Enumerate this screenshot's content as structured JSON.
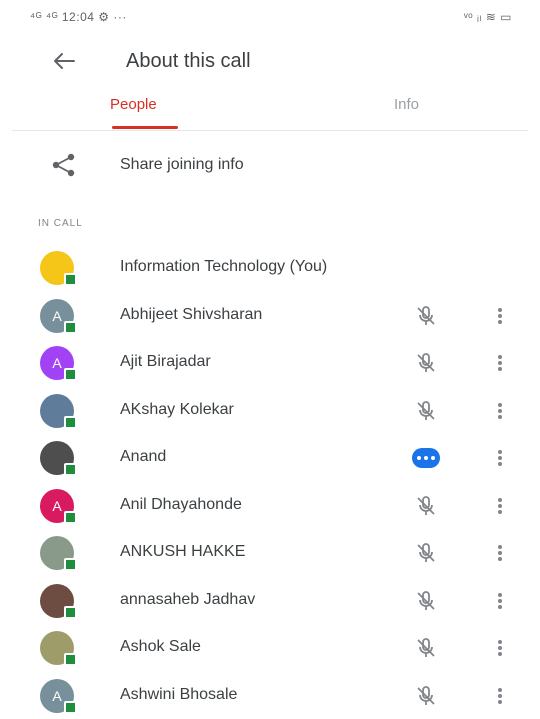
{
  "status_bar": {
    "left_text": "⁴ᴳ ⁴ᴳ 12:04 ⚙ ···",
    "right_text": "ᵛᵒ ᵢₗ ≋ ▭"
  },
  "app_bar": {
    "back_icon": "arrow-back-icon",
    "title": "About this call"
  },
  "tabs": {
    "items": [
      {
        "label": "People",
        "active": true
      },
      {
        "label": "Info",
        "active": false
      }
    ],
    "active_color": "#d93025"
  },
  "share": {
    "icon": "share-icon",
    "label": "Share joining info"
  },
  "section": {
    "in_call_label": "IN CALL"
  },
  "participants": [
    {
      "name": "Information Technology (You)",
      "initial": "",
      "avatar_color": "#f5c518",
      "state": "none"
    },
    {
      "name": "Abhijeet Shivsharan",
      "initial": "A",
      "avatar_color": "#78909c",
      "state": "muted"
    },
    {
      "name": "Ajit Birajadar",
      "initial": "A",
      "avatar_color": "#a142f4",
      "state": "muted"
    },
    {
      "name": "AKshay Kolekar",
      "initial": "",
      "avatar_color": "#5f7d9a",
      "state": "muted"
    },
    {
      "name": "Anand",
      "initial": "",
      "avatar_color": "#4e4e4e",
      "state": "speaking"
    },
    {
      "name": "Anil Dhayahonde",
      "initial": "A",
      "avatar_color": "#d81b60",
      "state": "muted"
    },
    {
      "name": "ANKUSH HAKKE",
      "initial": "",
      "avatar_color": "#8a9a8a",
      "state": "muted"
    },
    {
      "name": "annasaheb Jadhav",
      "initial": "",
      "avatar_color": "#6d4c41",
      "state": "muted"
    },
    {
      "name": "Ashok Sale",
      "initial": "",
      "avatar_color": "#9e9d6a",
      "state": "muted"
    },
    {
      "name": "Ashwini Bhosale",
      "initial": "A",
      "avatar_color": "#78909c",
      "state": "muted"
    }
  ]
}
